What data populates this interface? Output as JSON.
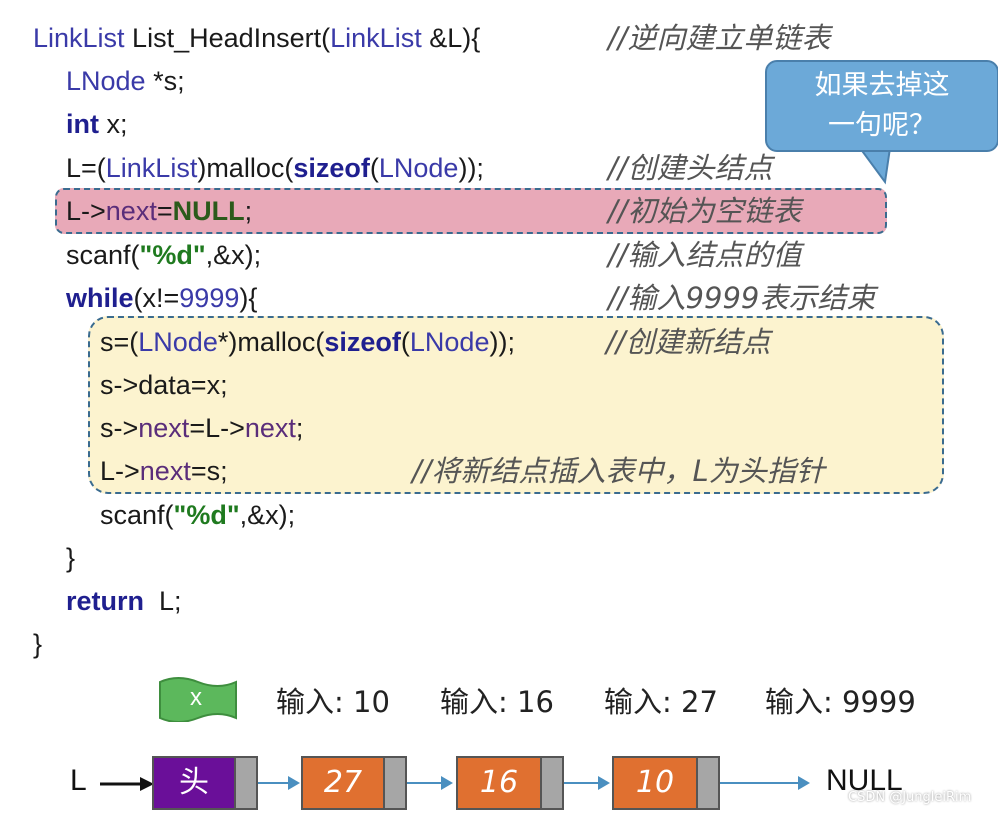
{
  "code": {
    "l1_a": "LinkList",
    "l1_b": " List_HeadInsert(",
    "l1_c": "LinkList",
    "l1_d": " &L){",
    "l1_cmt": "//逆向建立单链表",
    "l2_a": "LNode",
    "l2_b": " *s;",
    "l3_a": "int",
    "l3_b": " x;",
    "l4_a": "L=(",
    "l4_b": "LinkList",
    "l4_c": ")malloc(",
    "l4_d": "sizeof",
    "l4_e": "(",
    "l4_f": "LNode",
    "l4_g": "));",
    "l4_cmt": "//创建头结点",
    "l5_a": "L->",
    "l5_b": "next",
    "l5_c": "=",
    "l5_d": "NULL",
    "l5_e": ";",
    "l5_cmt": "//初始为空链表",
    "l6_a": "scanf(",
    "l6_b": "\"%d\"",
    "l6_c": ",&x);",
    "l6_cmt": "//输入结点的值",
    "l7_a": "while",
    "l7_b": "(x!=",
    "l7_c": "9999",
    "l7_d": "){",
    "l7_cmt": "//输入9999表示结束",
    "l8_a": "s=(",
    "l8_b": "LNode",
    "l8_c": "*)malloc(",
    "l8_d": "sizeof",
    "l8_e": "(",
    "l8_f": "LNode",
    "l8_g": "));",
    "l8_cmt": "//创建新结点",
    "l9": "s->data=x;",
    "l10_a": "s->",
    "l10_b": "next",
    "l10_c": "=L->",
    "l10_d": "next",
    "l10_e": ";",
    "l11_a": "L->",
    "l11_b": "next",
    "l11_c": "=s;",
    "l11_cmt": "//将新结点插入表中，L为头指针",
    "l12_a": "scanf(",
    "l12_b": "\"%d\"",
    "l12_c": ",&x);",
    "l13": "}",
    "l14_a": "return",
    "l14_b": "  L;",
    "l15": "}"
  },
  "callout": {
    "line1": "如果去掉这",
    "line2": "一句呢？"
  },
  "inputs": {
    "flag_label": "x",
    "items": [
      "输入: 10",
      "输入: 16",
      "输入: 27",
      "输入: 9999"
    ]
  },
  "list": {
    "pointer_label": "L",
    "head_label": "头",
    "nodes": [
      "27",
      "16",
      "10"
    ],
    "end_label": "NULL"
  },
  "watermark": "CSDN @JungleiRim",
  "colors": {
    "head_node": "#6a0f99",
    "data_node": "#e07030",
    "pointer_cell": "#a6a6a6",
    "highlight_red": "#e8a9b8",
    "highlight_yellow": "#fcf3cf",
    "callout": "#6ca9d8",
    "flag": "#5cb85c"
  }
}
